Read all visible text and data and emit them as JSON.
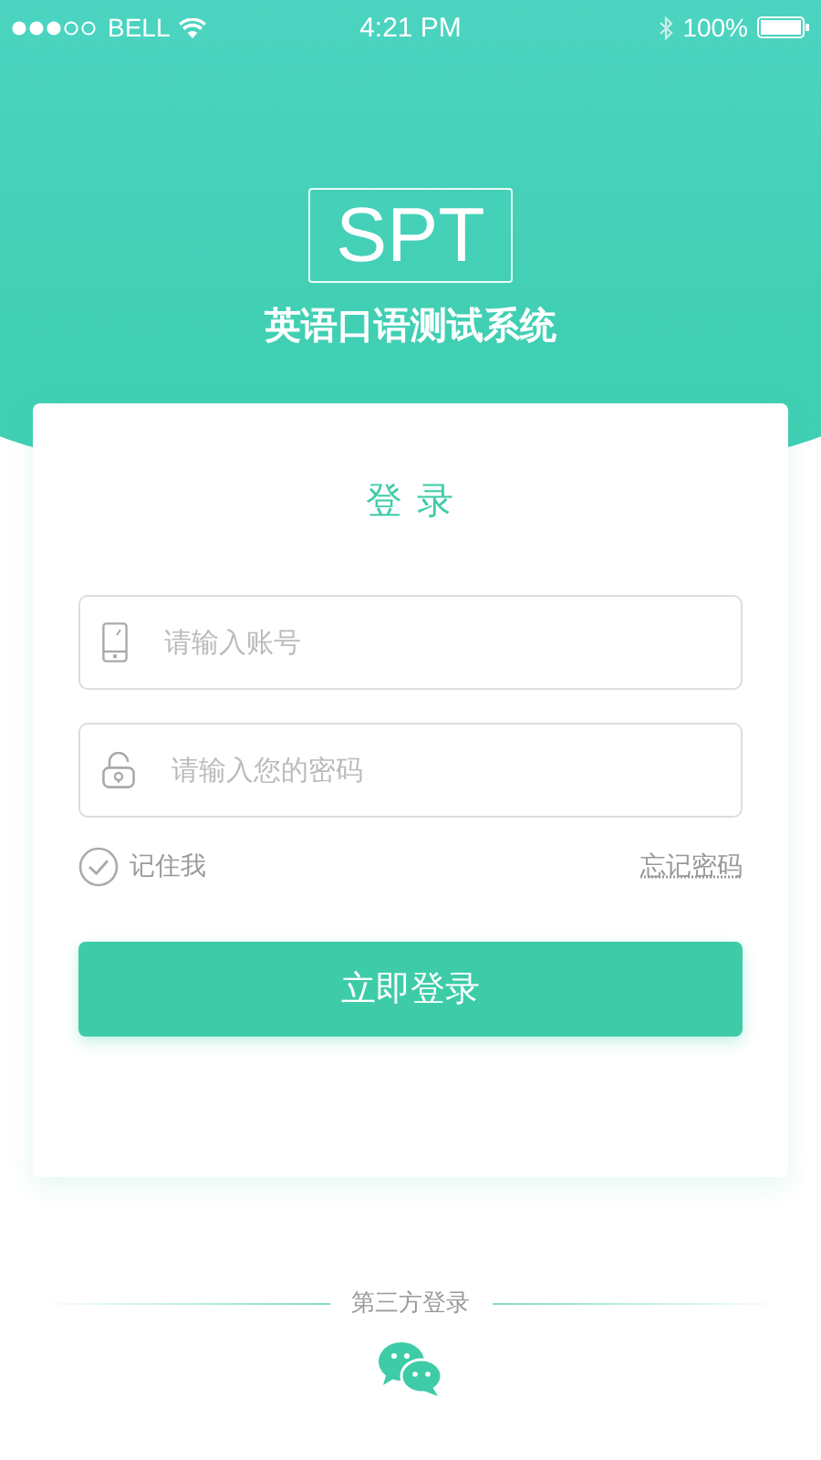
{
  "status_bar": {
    "carrier": "BELL",
    "time": "4:21 PM",
    "battery": "100%"
  },
  "logo": "SPT",
  "app_title": "英语口语测试系统",
  "login_card": {
    "title": "登 录",
    "fields": [
      {
        "kind": "account",
        "placeholder": "请输入账号"
      },
      {
        "kind": "password",
        "placeholder": "请输入您的密码"
      }
    ],
    "remember": {
      "label": "记住我",
      "checked": false
    },
    "forgot_link": "忘记密码",
    "submit_button": "立即登录"
  },
  "third_party": {
    "label": "第三方登录"
  }
}
